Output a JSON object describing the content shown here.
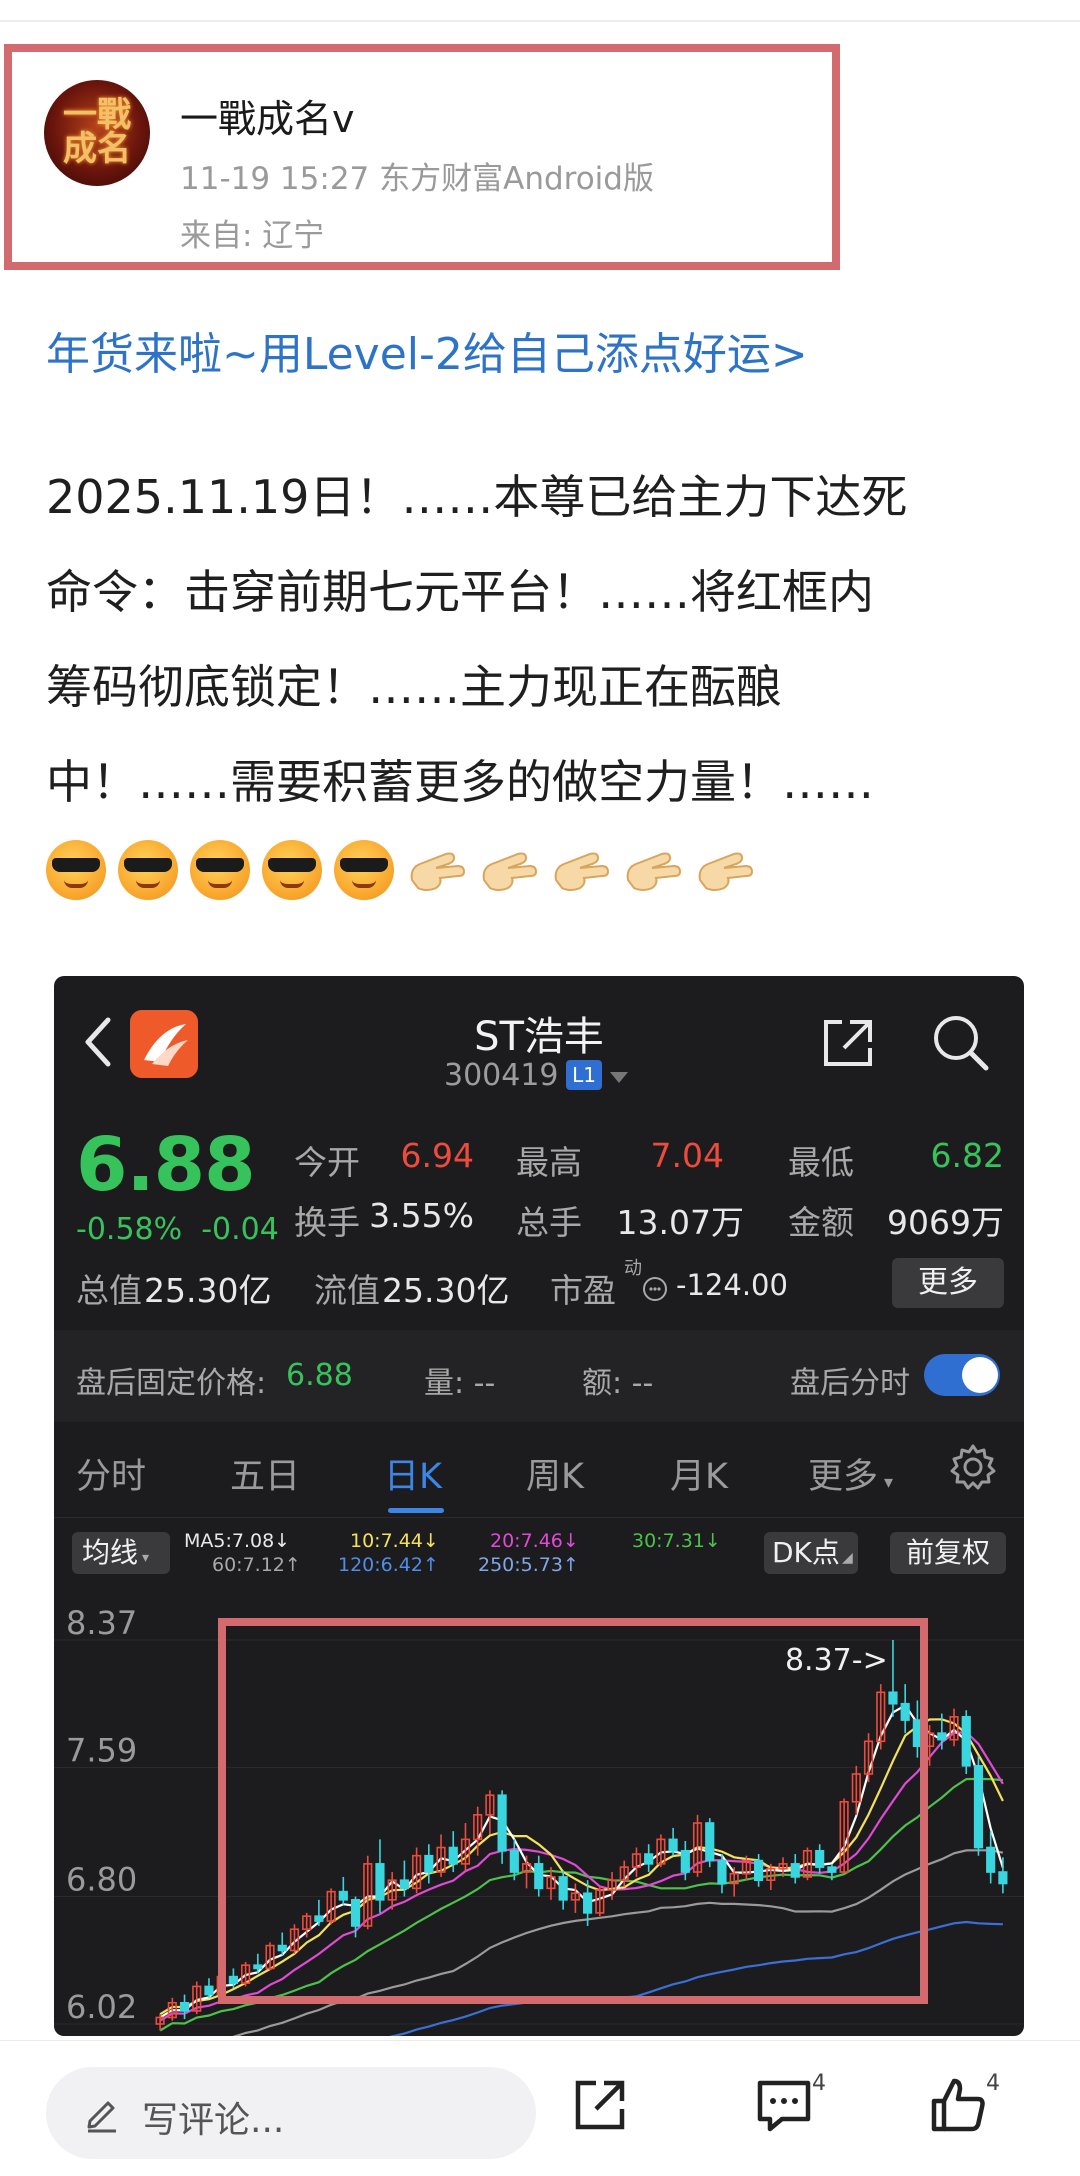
{
  "author": {
    "name": "一戰成名v",
    "meta": "11-19 15:27 东方财富Android版",
    "location": "来自: 辽宁",
    "avatar_text": "一戰成名"
  },
  "promo_link": "年货来啦~用Level-2给自己添点好运>",
  "body_lines": [
    "2025.11.19日！……本尊已给主力下达死",
    "命令：击穿前期七元平台！……将红框内",
    "筹码彻底锁定！……主力现正在酝酿",
    "中！……需要积蓄更多的做空力量！……"
  ],
  "emojis": [
    "cool-face",
    "cool-face",
    "cool-face",
    "cool-face",
    "cool-face",
    "pointing-hand",
    "pointing-hand",
    "pointing-hand",
    "pointing-hand",
    "pointing-hand"
  ],
  "stock": {
    "name": "ST浩丰",
    "code": "300419",
    "level_badge": "L1",
    "price": "6.88",
    "change_pct": "-0.58%",
    "change_abs": "-0.04",
    "quotes": {
      "open_label": "今开",
      "open": "6.94",
      "high_label": "最高",
      "high": "7.04",
      "low_label": "最低",
      "low": "6.82",
      "turnover_label": "换手",
      "turnover": "3.55%",
      "volume_label": "总手",
      "volume": "13.07万",
      "amount_label": "金额",
      "amount": "9069万",
      "mktcap_label": "总值",
      "mktcap": "25.30亿",
      "float_label": "流值",
      "float": "25.30亿",
      "pe_label": "市盈",
      "pe_sup": "动",
      "pe": "-124.00",
      "more": "更多"
    },
    "after_hours": {
      "label": "盘后固定价格:",
      "price": "6.88",
      "volume": "量: --",
      "amount": "额: --",
      "time_label": "盘后分时"
    },
    "tabs": [
      "分时",
      "五日",
      "日K",
      "周K",
      "月K",
      "更多"
    ],
    "active_tab": "日K",
    "ma_pill": "均线",
    "ma": {
      "ma5": "MA5:7.08↓",
      "ma60": "60:7.12↑",
      "ma10": "10:7.44↓",
      "ma120": "120:6.42↑",
      "ma20": "20:7.46↓",
      "ma250": "250:5.73↑",
      "ma30": "30:7.31↓"
    },
    "dk_pill": "DK点",
    "adj_pill": "前复权",
    "colors": {
      "up": "#ee4b3c",
      "down": "#3ad6e0",
      "accent": "#2f6fd1",
      "price_green": "#37c35b",
      "highlight_box": "#d26a6e"
    }
  },
  "chart_data": {
    "type": "candlestick",
    "y_ticks": [
      "8.37",
      "7.59",
      "6.80",
      "6.02"
    ],
    "ylim": [
      6.02,
      8.37
    ],
    "annotation": "8.37->",
    "highlight_box_color": "#d26a6e",
    "candles": [
      [
        6.02,
        6.08,
        5.98,
        6.06
      ],
      [
        6.06,
        6.18,
        6.04,
        6.15
      ],
      [
        6.15,
        6.2,
        6.05,
        6.1
      ],
      [
        6.1,
        6.28,
        6.08,
        6.25
      ],
      [
        6.25,
        6.3,
        6.18,
        6.2
      ],
      [
        6.2,
        6.33,
        6.18,
        6.31
      ],
      [
        6.31,
        6.36,
        6.24,
        6.27
      ],
      [
        6.27,
        6.4,
        6.25,
        6.38
      ],
      [
        6.38,
        6.45,
        6.33,
        6.36
      ],
      [
        6.36,
        6.52,
        6.35,
        6.5
      ],
      [
        6.5,
        6.58,
        6.44,
        6.47
      ],
      [
        6.47,
        6.63,
        6.45,
        6.6
      ],
      [
        6.6,
        6.7,
        6.55,
        6.68
      ],
      [
        6.68,
        6.78,
        6.62,
        6.65
      ],
      [
        6.65,
        6.85,
        6.63,
        6.83
      ],
      [
        6.83,
        6.92,
        6.75,
        6.78
      ],
      [
        6.78,
        6.8,
        6.55,
        6.62
      ],
      [
        6.62,
        7.05,
        6.6,
        7.0
      ],
      [
        7.0,
        7.15,
        6.7,
        6.78
      ],
      [
        6.78,
        6.95,
        6.72,
        6.9
      ],
      [
        6.9,
        7.02,
        6.8,
        6.85
      ],
      [
        6.85,
        7.1,
        6.82,
        7.05
      ],
      [
        7.05,
        7.12,
        6.88,
        6.95
      ],
      [
        6.95,
        7.18,
        6.92,
        7.1
      ],
      [
        7.1,
        7.2,
        6.95,
        7.0
      ],
      [
        7.0,
        7.25,
        6.96,
        7.15
      ],
      [
        7.15,
        7.35,
        7.05,
        7.3
      ],
      [
        7.3,
        7.45,
        7.18,
        7.42
      ],
      [
        7.42,
        7.45,
        7.0,
        7.08
      ],
      [
        7.08,
        7.15,
        6.9,
        6.95
      ],
      [
        6.95,
        7.05,
        6.85,
        7.0
      ],
      [
        7.0,
        7.05,
        6.8,
        6.85
      ],
      [
        6.85,
        6.98,
        6.78,
        6.92
      ],
      [
        6.92,
        6.96,
        6.72,
        6.78
      ],
      [
        6.78,
        6.88,
        6.7,
        6.82
      ],
      [
        6.82,
        6.9,
        6.62,
        6.7
      ],
      [
        6.7,
        6.86,
        6.68,
        6.84
      ],
      [
        6.84,
        6.95,
        6.78,
        6.9
      ],
      [
        6.9,
        7.02,
        6.86,
        6.98
      ],
      [
        6.98,
        7.1,
        6.92,
        7.06
      ],
      [
        7.06,
        7.12,
        6.95,
        7.0
      ],
      [
        7.0,
        7.18,
        6.98,
        7.15
      ],
      [
        7.15,
        7.22,
        7.05,
        7.08
      ],
      [
        7.08,
        7.14,
        6.9,
        6.95
      ],
      [
        6.95,
        7.3,
        6.92,
        7.25
      ],
      [
        7.25,
        7.28,
        6.98,
        7.02
      ],
      [
        7.02,
        7.06,
        6.82,
        6.88
      ],
      [
        6.88,
        6.98,
        6.8,
        6.94
      ],
      [
        6.94,
        7.05,
        6.9,
        7.02
      ],
      [
        7.02,
        7.06,
        6.86,
        6.9
      ],
      [
        6.9,
        7.0,
        6.84,
        6.97
      ],
      [
        6.97,
        7.04,
        6.92,
        7.0
      ],
      [
        7.0,
        7.06,
        6.88,
        6.92
      ],
      [
        6.92,
        7.1,
        6.9,
        7.08
      ],
      [
        7.08,
        7.12,
        6.94,
        6.98
      ],
      [
        6.98,
        7.0,
        6.9,
        6.95
      ],
      [
        6.95,
        7.4,
        6.94,
        7.38
      ],
      [
        7.38,
        7.6,
        7.3,
        7.55
      ],
      [
        7.55,
        7.8,
        7.5,
        7.75
      ],
      [
        7.75,
        8.1,
        7.7,
        8.05
      ],
      [
        8.05,
        8.37,
        7.9,
        7.98
      ],
      [
        7.98,
        8.1,
        7.8,
        7.88
      ],
      [
        7.88,
        8.0,
        7.65,
        7.72
      ],
      [
        7.72,
        7.85,
        7.6,
        7.8
      ],
      [
        7.8,
        7.92,
        7.7,
        7.76
      ],
      [
        7.76,
        7.95,
        7.72,
        7.9
      ],
      [
        7.9,
        7.94,
        7.55,
        7.6
      ],
      [
        7.6,
        7.66,
        7.05,
        7.1
      ],
      [
        7.1,
        7.2,
        6.88,
        6.95
      ],
      [
        6.95,
        7.04,
        6.82,
        6.88
      ]
    ],
    "ma_colors": {
      "ma5": "#ffffff",
      "ma10": "#f2e15a",
      "ma20": "#e04ad6",
      "ma30": "#4cc24a",
      "ma60": "#9a9a9a",
      "ma120": "#3a6fd8"
    }
  },
  "bottom_bar": {
    "comment_placeholder": "写评论...",
    "comment_count": "4",
    "like_count": "4"
  }
}
